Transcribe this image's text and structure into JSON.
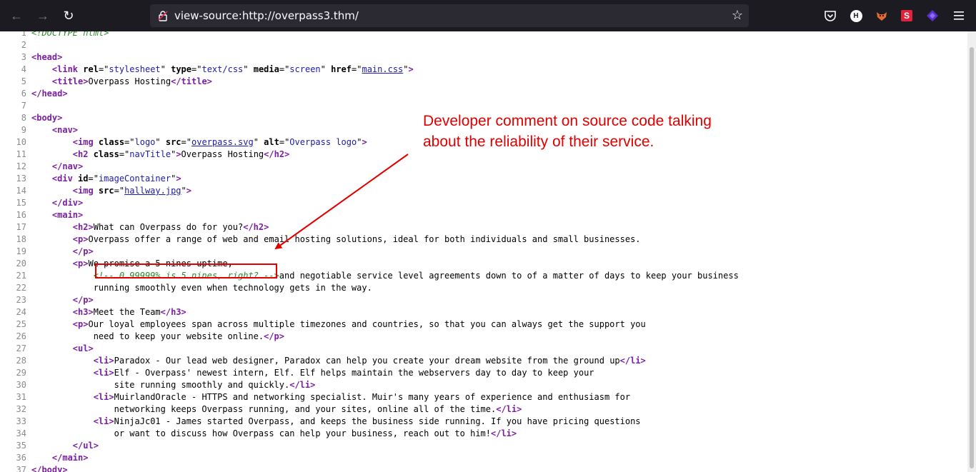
{
  "browser": {
    "url": "view-source:http://overpass3.thm/",
    "icons": [
      "back-icon",
      "forward-icon",
      "reload-icon",
      "lock-icon",
      "bookmark-star-icon",
      "pocket-icon",
      "extension-h-icon",
      "extension-fox-icon",
      "extension-s-icon",
      "extension-diamond-icon",
      "menu-icon"
    ],
    "ext_h_label": "H",
    "ext_s_label": "S"
  },
  "source_lines": [
    {
      "n": "1",
      "parts": [
        [
          "c",
          "&lt;!DOCTYPE html&gt;"
        ]
      ]
    },
    {
      "n": "2",
      "parts": []
    },
    {
      "n": "3",
      "parts": [
        [
          "t",
          "<head>"
        ]
      ]
    },
    {
      "n": "4",
      "parts": [
        [
          "x",
          "    "
        ],
        [
          "t",
          "<link "
        ],
        [
          "a",
          "rel"
        ],
        [
          "x",
          "=\""
        ],
        [
          "v",
          "stylesheet"
        ],
        [
          "x",
          "\" "
        ],
        [
          "a",
          "type"
        ],
        [
          "x",
          "=\""
        ],
        [
          "v",
          "text/css"
        ],
        [
          "x",
          "\" "
        ],
        [
          "a",
          "media"
        ],
        [
          "x",
          "=\""
        ],
        [
          "v",
          "screen"
        ],
        [
          "x",
          "\" "
        ],
        [
          "a",
          "href"
        ],
        [
          "x",
          "=\""
        ],
        [
          "l",
          "main.css"
        ],
        [
          "x",
          "\""
        ],
        [
          "t",
          ">"
        ]
      ]
    },
    {
      "n": "5",
      "parts": [
        [
          "x",
          "    "
        ],
        [
          "t",
          "<title"
        ],
        [
          "t",
          ">"
        ],
        [
          "x",
          "Overpass Hosting"
        ],
        [
          "t",
          "</title>"
        ]
      ]
    },
    {
      "n": "6",
      "parts": [
        [
          "t",
          "</head>"
        ]
      ]
    },
    {
      "n": "7",
      "parts": []
    },
    {
      "n": "8",
      "parts": [
        [
          "t",
          "<body>"
        ]
      ]
    },
    {
      "n": "9",
      "parts": [
        [
          "x",
          "    "
        ],
        [
          "t",
          "<nav>"
        ]
      ]
    },
    {
      "n": "10",
      "parts": [
        [
          "x",
          "        "
        ],
        [
          "t",
          "<img "
        ],
        [
          "a",
          "class"
        ],
        [
          "x",
          "=\""
        ],
        [
          "v",
          "logo"
        ],
        [
          "x",
          "\" "
        ],
        [
          "a",
          "src"
        ],
        [
          "x",
          "=\""
        ],
        [
          "l",
          "overpass.svg"
        ],
        [
          "x",
          "\" "
        ],
        [
          "a",
          "alt"
        ],
        [
          "x",
          "=\""
        ],
        [
          "v",
          "Overpass logo"
        ],
        [
          "x",
          "\""
        ],
        [
          "t",
          ">"
        ]
      ]
    },
    {
      "n": "11",
      "parts": [
        [
          "x",
          "        "
        ],
        [
          "t",
          "<h2 "
        ],
        [
          "a",
          "class"
        ],
        [
          "x",
          "=\""
        ],
        [
          "v",
          "navTitle"
        ],
        [
          "x",
          "\""
        ],
        [
          "t",
          ">"
        ],
        [
          "x",
          "Overpass Hosting"
        ],
        [
          "t",
          "</h2>"
        ]
      ]
    },
    {
      "n": "12",
      "parts": [
        [
          "x",
          "    "
        ],
        [
          "t",
          "</nav>"
        ]
      ]
    },
    {
      "n": "13",
      "parts": [
        [
          "x",
          "    "
        ],
        [
          "t",
          "<div "
        ],
        [
          "a",
          "id"
        ],
        [
          "x",
          "=\""
        ],
        [
          "v",
          "imageContainer"
        ],
        [
          "x",
          "\""
        ],
        [
          "t",
          ">"
        ]
      ]
    },
    {
      "n": "14",
      "parts": [
        [
          "x",
          "        "
        ],
        [
          "t",
          "<img "
        ],
        [
          "a",
          "src"
        ],
        [
          "x",
          "=\""
        ],
        [
          "l",
          "hallway.jpg"
        ],
        [
          "x",
          "\""
        ],
        [
          "t",
          ">"
        ]
      ]
    },
    {
      "n": "15",
      "parts": [
        [
          "x",
          "    "
        ],
        [
          "t",
          "</div>"
        ]
      ]
    },
    {
      "n": "16",
      "parts": [
        [
          "x",
          "    "
        ],
        [
          "t",
          "<main>"
        ]
      ]
    },
    {
      "n": "17",
      "parts": [
        [
          "x",
          "        "
        ],
        [
          "t",
          "<h2"
        ],
        [
          "t",
          ">"
        ],
        [
          "x",
          "What can Overpass do for you?"
        ],
        [
          "t",
          "</h2>"
        ]
      ]
    },
    {
      "n": "18",
      "parts": [
        [
          "x",
          "        "
        ],
        [
          "t",
          "<p"
        ],
        [
          "t",
          ">"
        ],
        [
          "x",
          "Overpass offer a range of web and email hosting solutions, ideal for both individuals and small businesses."
        ]
      ]
    },
    {
      "n": "19",
      "parts": [
        [
          "x",
          "        "
        ],
        [
          "t",
          "</p>"
        ]
      ]
    },
    {
      "n": "20",
      "parts": [
        [
          "x",
          "        "
        ],
        [
          "t",
          "<p"
        ],
        [
          "t",
          ">"
        ],
        [
          "x",
          "We promise a 5 nines uptime,"
        ]
      ]
    },
    {
      "n": "21",
      "parts": [
        [
          "x",
          "            "
        ],
        [
          "c",
          "<!-- 0.99999% is 5 nines, right? -->"
        ],
        [
          "x",
          "and negotiable service level agreements down to of a matter of days to keep your business"
        ]
      ]
    },
    {
      "n": "22",
      "parts": [
        [
          "x",
          "            running smoothly even when technology gets in the way."
        ]
      ]
    },
    {
      "n": "23",
      "parts": [
        [
          "x",
          "        "
        ],
        [
          "t",
          "</p>"
        ]
      ]
    },
    {
      "n": "24",
      "parts": [
        [
          "x",
          "        "
        ],
        [
          "t",
          "<h3"
        ],
        [
          "t",
          ">"
        ],
        [
          "x",
          "Meet the Team"
        ],
        [
          "t",
          "</h3>"
        ]
      ]
    },
    {
      "n": "25",
      "parts": [
        [
          "x",
          "        "
        ],
        [
          "t",
          "<p"
        ],
        [
          "t",
          ">"
        ],
        [
          "x",
          "Our loyal employees span across multiple timezones and countries, so that you can always get the support you"
        ]
      ]
    },
    {
      "n": "26",
      "parts": [
        [
          "x",
          "            need to keep your website online."
        ],
        [
          "t",
          "</p>"
        ]
      ]
    },
    {
      "n": "27",
      "parts": [
        [
          "x",
          "        "
        ],
        [
          "t",
          "<ul>"
        ]
      ]
    },
    {
      "n": "28",
      "parts": [
        [
          "x",
          "            "
        ],
        [
          "t",
          "<li"
        ],
        [
          "t",
          ">"
        ],
        [
          "x",
          "Paradox - Our lead web designer, Paradox can help you create your dream website from the ground up"
        ],
        [
          "t",
          "</li>"
        ]
      ]
    },
    {
      "n": "29",
      "parts": [
        [
          "x",
          "            "
        ],
        [
          "t",
          "<li"
        ],
        [
          "t",
          ">"
        ],
        [
          "x",
          "Elf - Overpass' newest intern, Elf. Elf helps maintain the webservers day to day to keep your"
        ]
      ]
    },
    {
      "n": "30",
      "parts": [
        [
          "x",
          "                site running smoothly and quickly."
        ],
        [
          "t",
          "</li>"
        ]
      ]
    },
    {
      "n": "31",
      "parts": [
        [
          "x",
          "            "
        ],
        [
          "t",
          "<li"
        ],
        [
          "t",
          ">"
        ],
        [
          "x",
          "MuirlandOracle - HTTPS and networking specialist. Muir's many years of experience and enthusiasm for"
        ]
      ]
    },
    {
      "n": "32",
      "parts": [
        [
          "x",
          "                networking keeps Overpass running, and your sites, online all of the time."
        ],
        [
          "t",
          "</li>"
        ]
      ]
    },
    {
      "n": "33",
      "parts": [
        [
          "x",
          "            "
        ],
        [
          "t",
          "<li"
        ],
        [
          "t",
          ">"
        ],
        [
          "x",
          "NinjaJc01 - James started Overpass, and keeps the business side running. If you have pricing questions"
        ]
      ]
    },
    {
      "n": "34",
      "parts": [
        [
          "x",
          "                or want to discuss how Overpass can help your business, reach out to him!"
        ],
        [
          "t",
          "</li>"
        ]
      ]
    },
    {
      "n": "35",
      "parts": [
        [
          "x",
          "        "
        ],
        [
          "t",
          "</ul>"
        ]
      ]
    },
    {
      "n": "36",
      "parts": [
        [
          "x",
          "    "
        ],
        [
          "t",
          "</main>"
        ]
      ]
    },
    {
      "n": "37",
      "parts": [
        [
          "t",
          "</body>"
        ]
      ]
    }
  ],
  "annotation": {
    "line1": "Developer comment on source code talking",
    "line2": "about the reliability of their service.",
    "color": "#e00000"
  }
}
